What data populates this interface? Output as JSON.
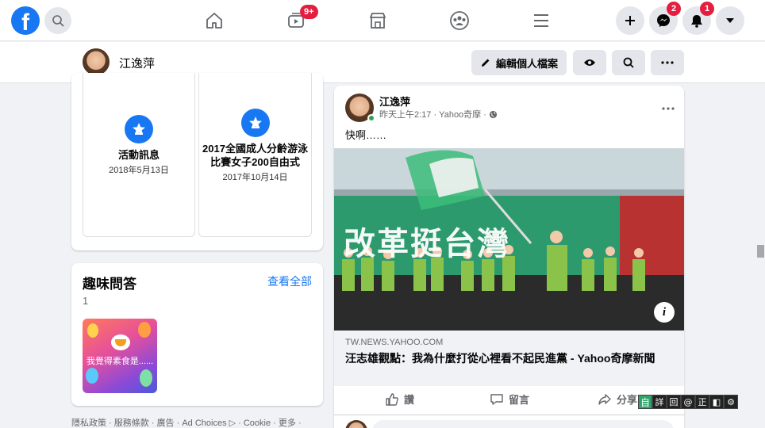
{
  "topbar": {
    "logo": "f",
    "nav": [
      {
        "icon": "home-icon",
        "badge": ""
      },
      {
        "icon": "watch-icon",
        "badge": "9+"
      },
      {
        "icon": "marketplace-icon",
        "badge": ""
      },
      {
        "icon": "groups-icon",
        "badge": ""
      },
      {
        "icon": "menu-icon",
        "badge": ""
      }
    ],
    "messenger_badge": "2",
    "notifications_badge": "1"
  },
  "profile_bar": {
    "name": "江逸萍",
    "edit_label": "編輯個人檔案"
  },
  "life_events": [
    {
      "title": "活動訊息",
      "date": "2018年5月13日"
    },
    {
      "title": "2017全國成人分齡游泳比賽女子200自由式",
      "date": "2017年10月14日"
    }
  ],
  "quiz": {
    "title": "趣味問答",
    "see_all": "查看全部",
    "count": "1",
    "item_text": "我覺得素食是......"
  },
  "footer": {
    "links": "隱私政策 · 服務條款 · 廣告 · Ad Choices ▷ · Cookie · 更多 ·"
  },
  "post": {
    "author": "江逸萍",
    "meta": "昨天上午2:17 · Yahoo奇摩 ·",
    "text": "快啊……",
    "image_text": "改革挺台灣",
    "link_domain": "TW.NEWS.YAHOO.COM",
    "link_title": "汪志雄觀點：我為什麼打從心裡看不起民進黨 - Yahoo奇摩新聞",
    "actions": {
      "like": "讚",
      "comment": "留言",
      "share": "分享"
    }
  },
  "ime_bar": [
    "自",
    "詳",
    "回",
    "@",
    "正",
    "◧",
    "⚙"
  ],
  "colors": {
    "brand": "#1877f2",
    "badge": "#e41e3f"
  }
}
